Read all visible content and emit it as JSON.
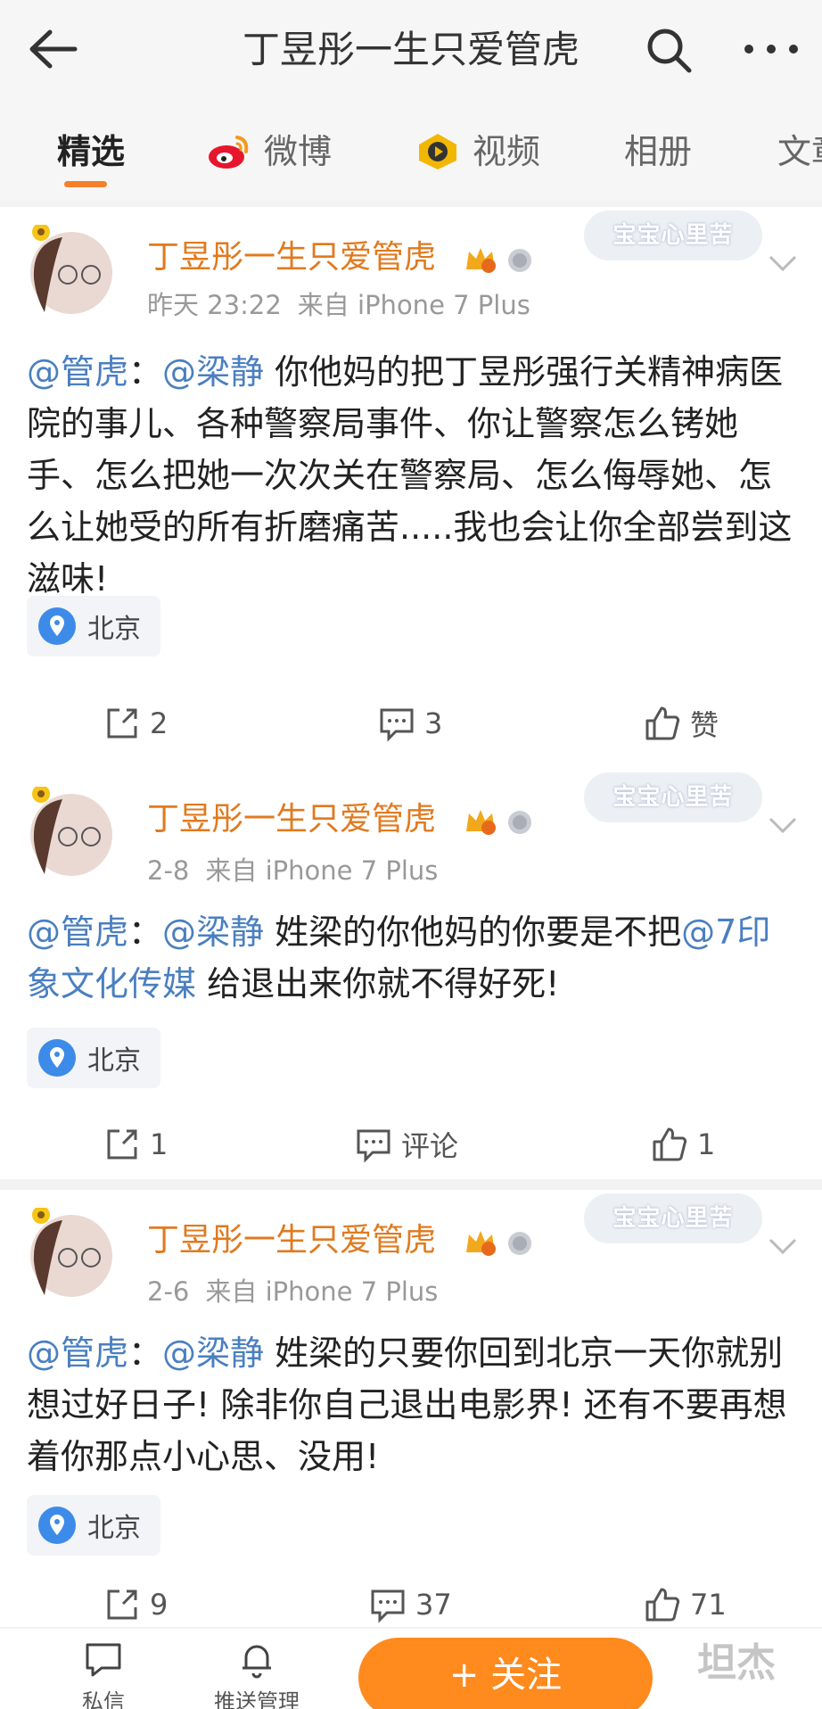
{
  "header": {
    "title": "丁昱彤一生只爱管虎",
    "back_icon": "back-arrow-icon",
    "search_icon": "search-icon",
    "more_icon": "more-icon"
  },
  "tabs": [
    {
      "label": "精选",
      "active": true
    },
    {
      "label": "微博",
      "icon": "weibo-icon"
    },
    {
      "label": "视频",
      "icon": "video-icon"
    },
    {
      "label": "相册"
    },
    {
      "label": "文章"
    }
  ],
  "posts": [
    {
      "author": "丁昱彤一生只爱管虎",
      "sticker": "宝宝心里苦",
      "time": "昨天 23:22",
      "source": "来自 iPhone 7 Plus",
      "mention1": "@管虎",
      "sep": "：",
      "mention2": "@梁静",
      "text": " 你他妈的把丁昱彤强行关精神病医院的事儿、各种警察局事件、你让警察怎么铐她手、怎么把她一次次关在警察局、怎么侮辱她、怎么让她受的所有折磨痛苦.....我也会让你全部尝到这滋味!",
      "location": "北京",
      "reposts": "2",
      "comments": "3",
      "likes": "赞"
    },
    {
      "author": "丁昱彤一生只爱管虎",
      "sticker": "宝宝心里苦",
      "time": "2-8",
      "source": "来自 iPhone 7 Plus",
      "mention1": "@管虎",
      "sep": "：",
      "mention2": "@梁静",
      "text": " 姓梁的你他妈的你要是不把",
      "mention3": "@7印象文化传媒",
      "text2": " 给退出来你就不得好死!",
      "location": "北京",
      "reposts": "1",
      "comments": "评论",
      "likes": "1"
    },
    {
      "author": "丁昱彤一生只爱管虎",
      "sticker": "宝宝心里苦",
      "time": "2-6",
      "source": "来自 iPhone 7 Plus",
      "mention1": "@管虎",
      "sep": "：",
      "mention2": "@梁静",
      "text": " 姓梁的只要你回到北京一天你就别想过好日子! 除非你自己退出电影界! 还有不要再想着你那点小心思、没用!",
      "location": "北京",
      "reposts": "9",
      "comments": "37",
      "likes": "71"
    }
  ],
  "bottom_bar": {
    "message_label": "私信",
    "push_label": "推送管理",
    "follow_label": "+ 关注",
    "watermark": "坦杰"
  },
  "colors": {
    "accent": "#f5802a",
    "name": "#e07a1f",
    "mention": "#4a7fc0",
    "follow": "#ff8a1e"
  }
}
